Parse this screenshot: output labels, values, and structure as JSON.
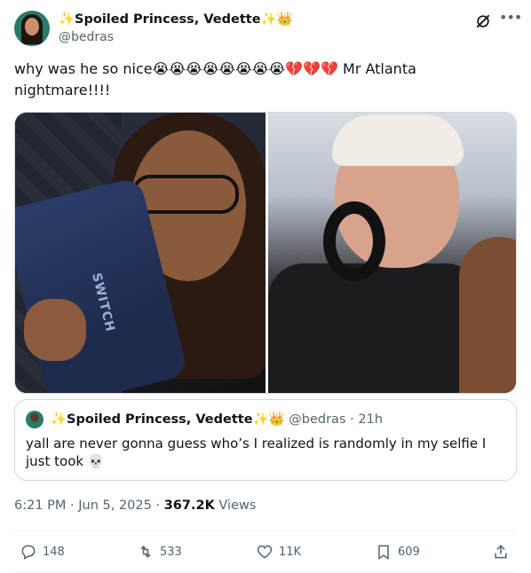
{
  "author": {
    "display_name": "✨Spoiled Princess, Vedette✨👑",
    "handle": "@bedras"
  },
  "tweet": {
    "text": "why was he so nice😭😭😭😭😭😭😭😭💔💔💔 Mr Atlanta nightmare!!!!"
  },
  "media": {
    "left_case_label": "SWITCH"
  },
  "quoted": {
    "display_name": "✨Spoiled Princess, Vedette✨👑",
    "meta": "@bedras · 21h",
    "text": "yall are never gonna guess who’s I realized is randomly in my selfie I just took 💀"
  },
  "meta": {
    "time_date": "6:21 PM · Jun 5, 2025 · ",
    "views_count": "367.2K",
    "views_label": " Views"
  },
  "actions": {
    "replies": "148",
    "reposts": "533",
    "likes": "11K",
    "bookmarks": "609"
  },
  "icons": {
    "more": "more-icon",
    "grok": "grok-icon",
    "reply": "reply-icon",
    "repost": "repost-icon",
    "like": "heart-icon",
    "bookmark": "bookmark-icon",
    "share": "share-icon"
  },
  "colors": {
    "text": "#0f1419",
    "secondary": "#536471",
    "border": "#cfd9de"
  }
}
